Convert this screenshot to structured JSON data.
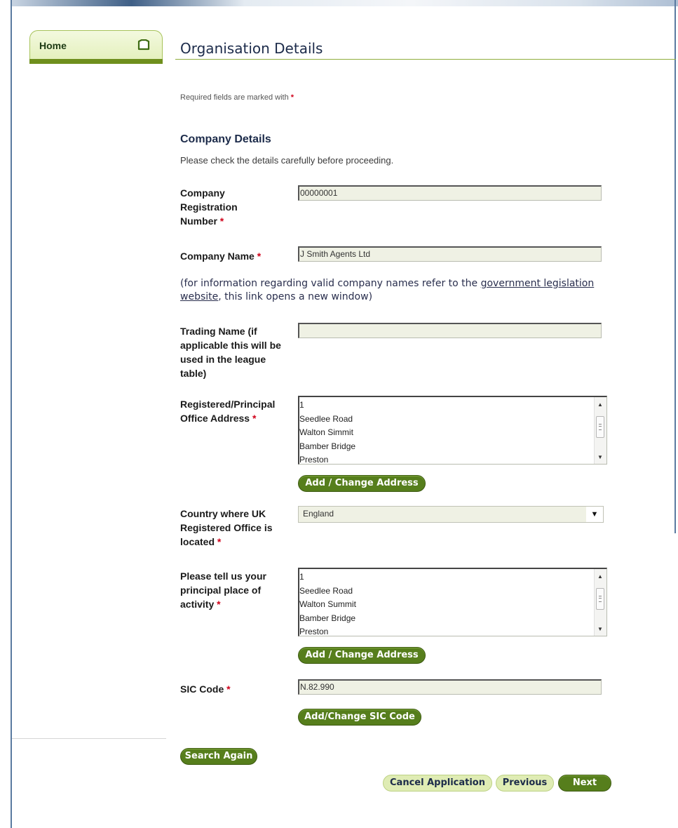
{
  "nav": {
    "home_label": "Home"
  },
  "page": {
    "title": "Organisation Details"
  },
  "required_note": {
    "text": "Required fields are marked with",
    "star": "*"
  },
  "section": {
    "title": "Company Details",
    "subtitle": "Please check the details carefully before proceeding."
  },
  "fields": {
    "reg_number": {
      "label": "Company Registration Number",
      "value": "00000001"
    },
    "company_name": {
      "label": "Company Name",
      "value": "J Smith Agents Ltd"
    },
    "info_text": {
      "before": "(for information regarding valid company names refer to the",
      "link": "government legislation website",
      "after": ", this link opens a new window)"
    },
    "trading_name": {
      "label": "Trading Name (if applicable this will be used in the league table)",
      "value": ""
    },
    "office_address": {
      "label": "Registered/Principal Office Address",
      "lines": [
        "1",
        "Seedlee Road",
        "Walton Simmit",
        "Bamber Bridge",
        "Preston"
      ],
      "button": "Add / Change Address"
    },
    "country": {
      "label": "Country where UK Registered Office is located",
      "value": "England"
    },
    "activity_address": {
      "label": "Please tell us your principal place of activity",
      "lines": [
        "1",
        "Seedlee Road",
        "Walton Summit",
        "Bamber Bridge",
        "Preston"
      ],
      "button": "Add / Change Address"
    },
    "sic": {
      "label": "SIC Code",
      "value": "N.82.990",
      "button": "Add/Change SIC Code"
    }
  },
  "actions": {
    "search_again": "Search Again",
    "cancel": "Cancel Application",
    "previous": "Previous",
    "next": "Next"
  },
  "colors": {
    "accent_green": "#567e1c",
    "light_green": "#dfecb4",
    "required_star": "#d0021b"
  }
}
